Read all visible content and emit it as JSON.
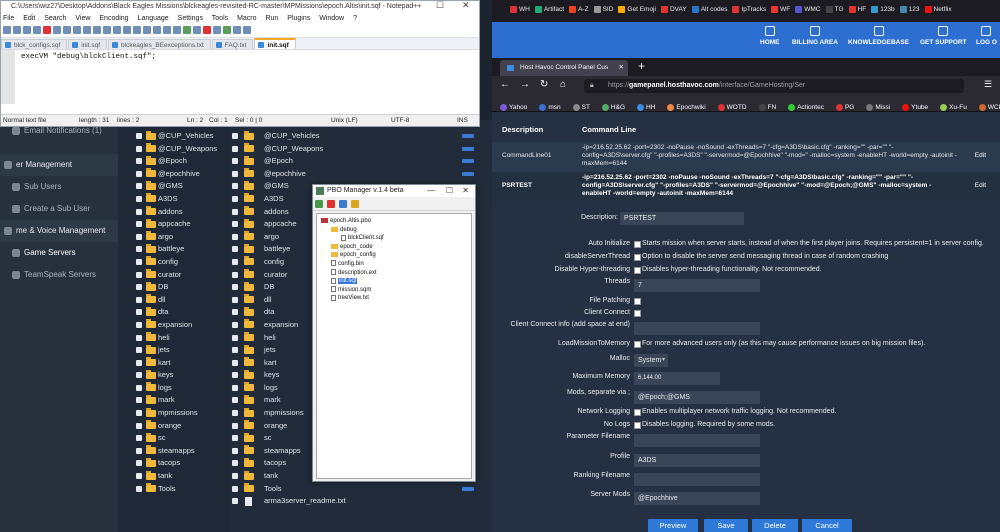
{
  "notepad": {
    "title": "C:\\Users\\wiz27\\Desktop\\Addons\\Black Eagles Missions\\blckeagles-revisited-RC-master\\MPMissions\\epoch.Altis\\init.sqf - Notepad++",
    "menu": [
      "File",
      "Edit",
      "Search",
      "View",
      "Encoding",
      "Language",
      "Settings",
      "Tools",
      "Macro",
      "Run",
      "Plugins",
      "Window",
      "?"
    ],
    "tabs": [
      "blck_configs.sqf",
      "init.sqf",
      "blckeagles_BEexceptions.txt",
      "FAQ.txt",
      "init.sqf"
    ],
    "code_line": "execVM \"debug\\blckClient.sqf\";",
    "status": {
      "type": "Normal text file",
      "length": "length : 31",
      "lines": "lines : 2",
      "ln": "Ln : 2",
      "col": "Col : 1",
      "sel": "Sel : 0 | 0",
      "eol": "Unix (LF)",
      "enc": "UTF-8",
      "ins": "INS"
    }
  },
  "sidebar": {
    "items": [
      "Email Notifications (1)",
      "er Management",
      "Sub Users",
      "Create a Sub User",
      "me & Voice Management",
      "Game Servers",
      "TeamSpeak Servers"
    ]
  },
  "tree1": [
    "@CUP_Vehicles",
    "@CUP_Weapons",
    "@Epoch",
    "@epochhive",
    "@GMS",
    "A3DS",
    "addons",
    "appcache",
    "argo",
    "battleye",
    "config",
    "curator",
    "DB",
    "dll",
    "dta",
    "expansion",
    "heli",
    "jets",
    "kart",
    "keys",
    "logs",
    "mark",
    "mpmissions",
    "orange",
    "sc",
    "steamapps",
    "tacops",
    "tank",
    "Tools"
  ],
  "tree2": [
    "@CUP_Vehicles",
    "@CUP_Weapons",
    "@Epoch",
    "@epochhive",
    "@GMS",
    "A3DS",
    "addons",
    "appcache",
    "argo",
    "battleye",
    "config",
    "curator",
    "DB",
    "dll",
    "dta",
    "expansion",
    "heli",
    "jets",
    "kart",
    "keys",
    "logs",
    "mark",
    "mpmissions",
    "orange",
    "sc",
    "steamapps",
    "tacops",
    "tank",
    "Tools"
  ],
  "tree2_file": "arma3server_readme.txt",
  "pbo": {
    "title": "PBO Manager v.1.4 beta",
    "tree": [
      {
        "label": "epoch.Altis.pbo",
        "kind": "root",
        "indent": 0
      },
      {
        "label": "debug",
        "kind": "folder",
        "indent": 1
      },
      {
        "label": "blckClient.sqf",
        "kind": "file",
        "indent": 2
      },
      {
        "label": "epoch_code",
        "kind": "folder",
        "indent": 1
      },
      {
        "label": "epoch_config",
        "kind": "folder",
        "indent": 1
      },
      {
        "label": "config.bin",
        "kind": "file",
        "indent": 1
      },
      {
        "label": "description.ext",
        "kind": "file",
        "indent": 1
      },
      {
        "label": "init.sqf",
        "kind": "file",
        "indent": 1,
        "selected": true
      },
      {
        "label": "mission.sqm",
        "kind": "file",
        "indent": 1
      },
      {
        "label": "treeView.txt",
        "kind": "file",
        "indent": 1
      }
    ]
  },
  "browser": {
    "bookmarks_top": [
      "WH",
      "Artifact",
      "A-Z",
      "SID",
      "Get Emoji",
      "DVAY",
      "Alt codes",
      "IpTracks",
      "WF",
      "WMC",
      "TG",
      "HF",
      "123b",
      "123",
      "Netflix"
    ],
    "nav": [
      "HOME",
      "BILLING AREA",
      "KNOWLEDGEBASE",
      "GET SUPPORT",
      "LOG O"
    ],
    "tab_title": "Host Havoc Control Panel Cus",
    "new_tab": "+",
    "url_host": "gamepanel.hosthavoc.com",
    "url_path": "/interface/GameHosting/Ser",
    "bookmarks": [
      "Yahoo",
      "msn",
      "ST",
      "H&G",
      "HH",
      "Epochwiki",
      "WOTD",
      "FN",
      "Actiontec",
      "PG",
      "Missi",
      "Ytube",
      "Xu-Fu",
      "WCP"
    ]
  },
  "commands": {
    "header_description": "Description",
    "header_command": "Command Line",
    "rows": [
      {
        "name": "CommandLine01",
        "cmd": "-ip=216.52.25.62 -port=2302 -noPause -noSound -exThreads=7 \"-cfg=A3DS\\basic.cfg\" -ranking=\"\" -par=\"\" \"-config=A3DS\\server.cfg\" \"-profiles=A3DS\" \"-servermod=@Epochhive\" \"-mod=\" -malloc=system -enableHT -world=empty -autoinit -maxMem=6144",
        "edit": "Edit"
      },
      {
        "name": "PSRTEST",
        "cmd": "-ip=216.52.25.62 -port=2302 -noPause -noSound -exThreads=7 \"-cfg=A3DS\\basic.cfg\" -ranking=\"\" -par=\"\" \"-config=A3DS\\server.cfg\" \"-profiles=A3DS\" \"-servermod=@Epochhive\" \"-mod=@Epoch;@GMS\" -malloc=system -enableHT -world=empty -autoinit -maxMem=6144",
        "edit": "Edit"
      }
    ]
  },
  "form": {
    "description_label": "Description:",
    "description_value": "PSRTEST",
    "auto_init_label": "Auto Initialize",
    "auto_init_desc": "Starts mission when server starts, instead of when the first player joins. Requires persistent=1 in server config.",
    "disable_thread_label": "disableServerThread",
    "disable_thread_desc": "Option to disable the server send messaging thread in case of random crashing",
    "disable_ht_label": "Disable Hyper-threading",
    "disable_ht_desc": "Disables hyper-threading functionality. Not recommended.",
    "threads_label": "Threads",
    "threads_value": "7",
    "file_patching_label": "File Patching",
    "client_connect_label": "Client Connect",
    "client_connect_info_label": "Client Connect info (add space at end)",
    "load_mission_label": "LoadMissionToMemory",
    "load_mission_desc": "For more advanced users only (as this may cause performance issues on big mission files).",
    "malloc_label": "Malloc",
    "malloc_value": "System",
    "max_memory_label": "Maximum Memory",
    "max_memory_value": "6,144.00",
    "mods_label": "Mods, separate via ;",
    "mods_value": "@Epoch;@GMS",
    "network_logging_label": "Network Logging",
    "network_logging_desc": "Enables multiplayer network traffic logging. Not recommended.",
    "no_logs_label": "No Logs",
    "no_logs_desc": "Disables logging. Required by some mods.",
    "parameter_label": "Parameter Filename",
    "profile_label": "Profile",
    "profile_value": "A3DS",
    "ranking_label": "Ranking Filename",
    "server_mods_label": "Server Mods",
    "server_mods_value": "@Epochhive"
  },
  "buttons": {
    "preview": "Preview",
    "save": "Save",
    "delete": "Delete",
    "cancel": "Cancel"
  },
  "colors": {
    "accent": "#2f79d8",
    "folder": "#f0b93c",
    "page_bg": "#253142"
  }
}
